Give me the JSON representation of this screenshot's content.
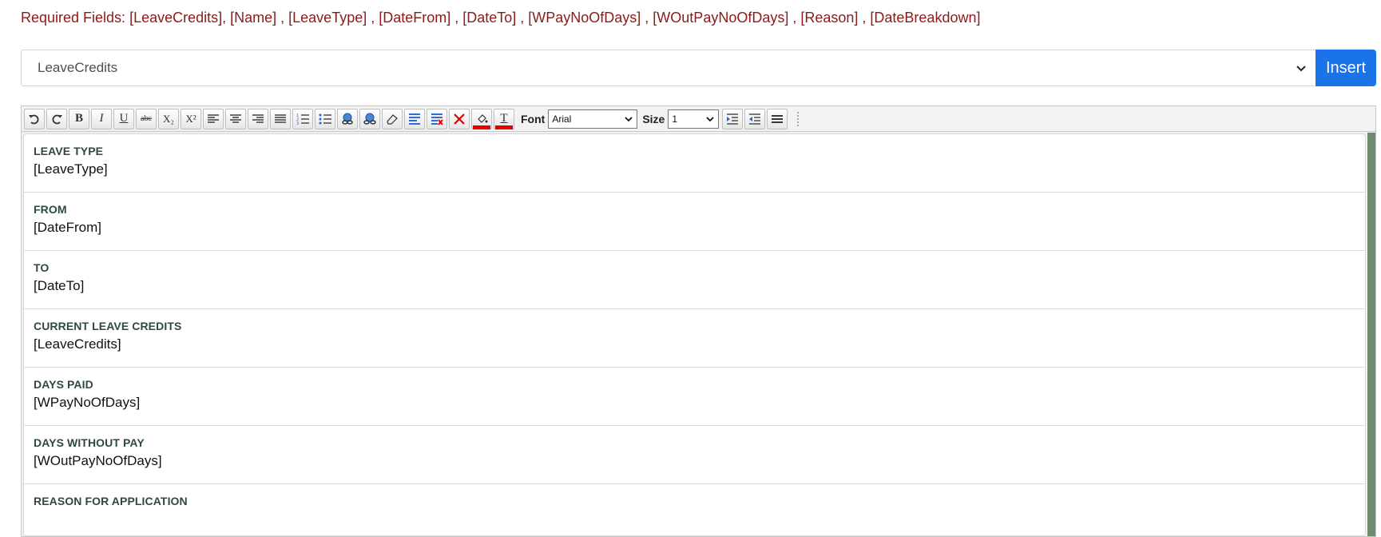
{
  "required_fields": "Required Fields: [LeaveCredits], [Name] , [LeaveType] , [DateFrom] , [DateTo] , [WPayNoOfDays] , [WOutPayNoOfDays] , [Reason] , [DateBreakdown]",
  "field_select": {
    "selected": "LeaveCredits"
  },
  "insert_button": "Insert",
  "toolbar": {
    "buttons": [
      {
        "name": "undo-icon"
      },
      {
        "name": "redo-icon"
      },
      {
        "name": "bold-icon",
        "glyph": "B"
      },
      {
        "name": "italic-icon",
        "glyph": "I"
      },
      {
        "name": "underline-icon",
        "glyph": "U"
      },
      {
        "name": "strikethrough-icon",
        "glyph": "abc"
      },
      {
        "name": "subscript-icon",
        "glyph": "X₂"
      },
      {
        "name": "superscript-icon",
        "glyph": "X²"
      },
      {
        "name": "align-left-icon"
      },
      {
        "name": "align-center-icon"
      },
      {
        "name": "align-right-icon"
      },
      {
        "name": "align-justify-icon"
      },
      {
        "name": "ordered-list-icon"
      },
      {
        "name": "unordered-list-icon"
      },
      {
        "name": "insert-link-icon"
      },
      {
        "name": "remove-link-icon"
      },
      {
        "name": "eraser-icon"
      },
      {
        "name": "block-format-icon"
      },
      {
        "name": "remove-format-icon"
      },
      {
        "name": "delete-icon"
      },
      {
        "name": "background-color-icon"
      },
      {
        "name": "text-color-icon",
        "glyph": "T"
      }
    ],
    "font_label": "Font",
    "font_value": "Arial",
    "size_label": "Size",
    "size_value": "1",
    "accent_red": "#e30000",
    "accent_blue": "#1a73e8"
  },
  "rows": [
    {
      "label": "LEAVE TYPE",
      "value": "[LeaveType]"
    },
    {
      "label": "FROM",
      "value": "[DateFrom]"
    },
    {
      "label": "TO",
      "value": "[DateTo]"
    },
    {
      "label": "CURRENT LEAVE CREDITS",
      "value": "[LeaveCredits]"
    },
    {
      "label": "DAYS PAID",
      "value": "[WPayNoOfDays]"
    },
    {
      "label": "DAYS WITHOUT PAY",
      "value": "[WOutPayNoOfDays]"
    },
    {
      "label": "REASON FOR APPLICATION",
      "value": ""
    }
  ]
}
